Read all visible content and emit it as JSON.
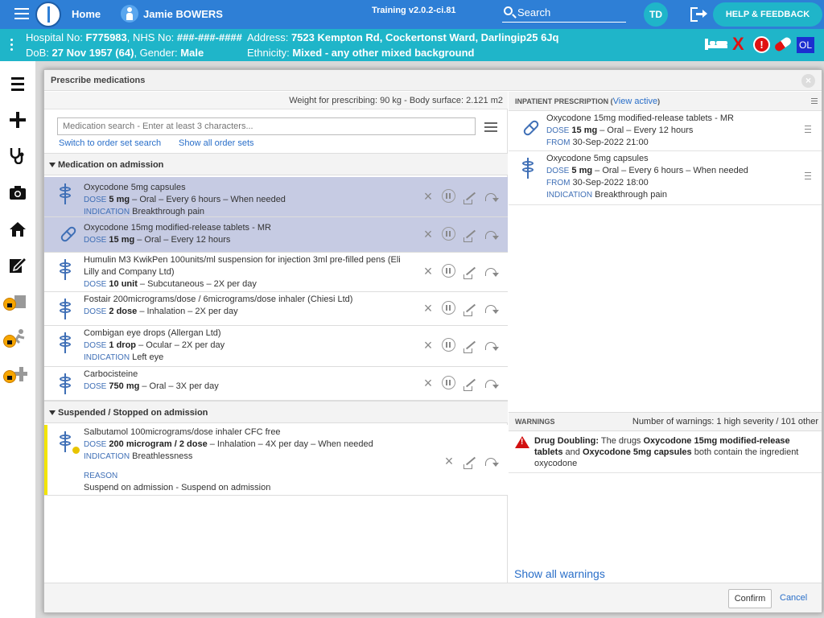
{
  "topbar": {
    "home_label": "Home",
    "patient_name": "Jamie BOWERS",
    "training_version": "Training v2.0.2-ci.81",
    "search_label": "Search",
    "avatar_initials": "TD",
    "help_label": "HELP & FEEDBACK"
  },
  "banner": {
    "hospital_no_label": "Hospital No:",
    "hospital_no": "F775983",
    "nhs_no_label": "NHS No:",
    "nhs_no": "###-###-####",
    "dob_label": "DoB:",
    "dob": "27 Nov 1957 (64)",
    "gender_label": "Gender:",
    "gender": "Male",
    "address_label": "Address:",
    "address": "7523 Kempton Rd, Cockertonst Ward, Darlingip25 6Jq",
    "ethnicity_label": "Ethnicity:",
    "ethnicity": "Mixed - any other mixed background",
    "alert_symbol": "!",
    "x_symbol": "X",
    "ol_label": "OL"
  },
  "modal": {
    "title": "Prescribe medications",
    "close_symbol": "×",
    "weight_text": "Weight for prescribing: 90 kg - Body surface: 2.121 m2",
    "search_placeholder": "Medication search - Enter at least 3 characters...",
    "link_order_set": "Switch to order set search",
    "link_all_sets": "Show all order sets",
    "section_admission": "Medication on admission",
    "section_suspended": "Suspended / Stopped on admission",
    "labels": {
      "dose": "DOSE",
      "indication": "INDICATION",
      "reason": "REASON",
      "from": "FROM"
    },
    "admission_meds": [
      {
        "name": "Oxycodone 5mg capsules",
        "dose": "5 mg",
        "route": " – Oral – Every 6 hours – When needed",
        "indication": "Breakthrough pain"
      },
      {
        "name": "Oxycodone 15mg modified-release tablets - MR",
        "dose": "15 mg",
        "route": " – Oral – Every 12 hours"
      },
      {
        "name": "Humulin M3 KwikPen 100units/ml suspension for injection 3ml pre-filled pens (Eli Lilly and Company Ltd)",
        "dose": "10 unit",
        "route": " – Subcutaneous – 2X per day"
      },
      {
        "name": "Fostair 200micrograms/dose / 6micrograms/dose inhaler (Chiesi Ltd)",
        "dose": "2 dose",
        "route": " – Inhalation – 2X per day"
      },
      {
        "name": "Combigan eye drops (Allergan Ltd)",
        "dose": "1 drop",
        "route": " – Ocular – 2X per day",
        "indication": "Left eye"
      },
      {
        "name": "Carbocisteine",
        "dose": "750 mg",
        "route": " – Oral – 3X per day"
      }
    ],
    "suspended_meds": [
      {
        "name": "Salbutamol 100micrograms/dose inhaler CFC free",
        "dose": "200 microgram / 2 dose",
        "route": " – Inhalation – 4X per day – When needed",
        "indication": "Breathlessness",
        "reason": "Suspend on admission - Suspend on admission"
      }
    ],
    "action_x": "×"
  },
  "inpatient": {
    "header": "INPATIENT PRESCRIPTION (",
    "view_active": "View active",
    "header_close": ")",
    "items": [
      {
        "name": "Oxycodone 15mg modified-release tablets - MR",
        "dose": "15 mg",
        "route": " – Oral – Every 12 hours",
        "from": "30-Sep-2022 21:00"
      },
      {
        "name": "Oxycodone 5mg capsules",
        "dose": "5 mg",
        "route": " – Oral – Every 6 hours – When needed",
        "from": "30-Sep-2022 18:00",
        "indication": "Breakthrough pain"
      }
    ]
  },
  "warnings": {
    "header": "WARNINGS",
    "count_text": "Number of warnings: 1 high severity / 101 other",
    "items": [
      {
        "title": "Drug Doubling:",
        "pre": " The drugs ",
        "drug_a": "Oxycodone 15mg modified-release tablets",
        "mid": " and ",
        "drug_b": "Oxycodone 5mg capsules",
        "post": " both contain the ingredient oxycodone"
      }
    ],
    "show_all": "Show all warnings"
  },
  "footer": {
    "confirm_label": "Confirm",
    "cancel_label": "Cancel"
  }
}
